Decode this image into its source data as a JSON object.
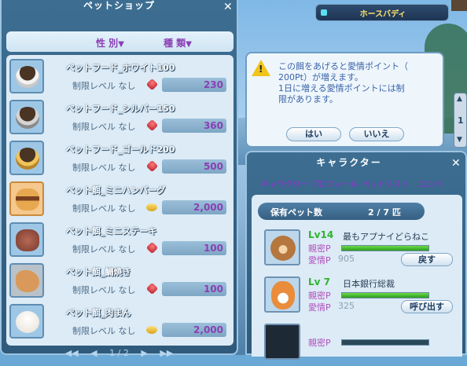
{
  "shop": {
    "title": "ペットショップ",
    "close": "✕",
    "filters": [
      {
        "label": "性 別",
        "arrow": "▼"
      },
      {
        "label": "種 類",
        "arrow": "▼"
      }
    ],
    "items": [
      {
        "name": "ペットフード_ホワイト100",
        "level": "制限レベル なし",
        "currency": "gem",
        "price": "230",
        "food": "bowl",
        "thumb": ""
      },
      {
        "name": "ペットフード_シルバー150",
        "level": "制限レベル なし",
        "currency": "gem",
        "price": "360",
        "food": "bowl-silver",
        "thumb": ""
      },
      {
        "name": "ペットフード_ゴールド200",
        "level": "制限レベル なし",
        "currency": "gem",
        "price": "500",
        "food": "bowl-gold",
        "thumb": ""
      },
      {
        "name": "ペット餌_ミニハンバーグ",
        "level": "制限レベル なし",
        "currency": "coin",
        "price": "2,000",
        "food": "burger",
        "thumb": "bg-orange"
      },
      {
        "name": "ペット餌_ミニステーキ",
        "level": "制限レベル なし",
        "currency": "gem",
        "price": "100",
        "food": "steak",
        "thumb": ""
      },
      {
        "name": "ペット餌_鯛焼き",
        "level": "制限レベル なし",
        "currency": "gem",
        "price": "100",
        "food": "taiyaki",
        "thumb": "bg-gray"
      },
      {
        "name": "ペット餌_肉まん",
        "level": "制限レベル なし",
        "currency": "coin",
        "price": "2,000",
        "food": "bun",
        "thumb": ""
      }
    ],
    "pager": {
      "first": "◀◀",
      "prev": "◀",
      "page": "1 / 2",
      "next": "▶",
      "last": "▶▶"
    }
  },
  "buddy": {
    "label": "ホースバディ"
  },
  "dialog": {
    "icon": "warning-icon",
    "mark": "!",
    "lines": [
      "この餌をあげると愛情ポイント（",
      "200Pt）が増えます。",
      "1日に増える愛情ポイントには制",
      "限があります。"
    ],
    "yes": "はい",
    "no": "いいえ"
  },
  "scroller": {
    "up": "▲",
    "value": "1",
    "down": "▼"
  },
  "character": {
    "title": "キャラクター",
    "close": "✕",
    "tabs": [
      "キャラクター",
      "プロフィール",
      "ペットリスト",
      "ユニベ"
    ],
    "count_label": "保有ペット数",
    "count_value": "2 / 7 匹",
    "pets": [
      {
        "lv": "Lv14",
        "name": "最もアプナイどらねこ",
        "secret_label": "親密P",
        "love_label": "愛情P",
        "love_value": "905",
        "secret_fill": 1.0,
        "button": "戻す"
      },
      {
        "lv": "Lv 7",
        "name": "日本銀行総裁",
        "secret_label": "親密P",
        "love_label": "愛情P",
        "love_value": "325",
        "secret_fill": 1.0,
        "button": "呼び出す"
      },
      {
        "secret_label": "親密P"
      }
    ]
  },
  "colors": {
    "accent": "#8a3fb5",
    "panel": "#3d6e92",
    "level_green": "#2fb32f"
  }
}
